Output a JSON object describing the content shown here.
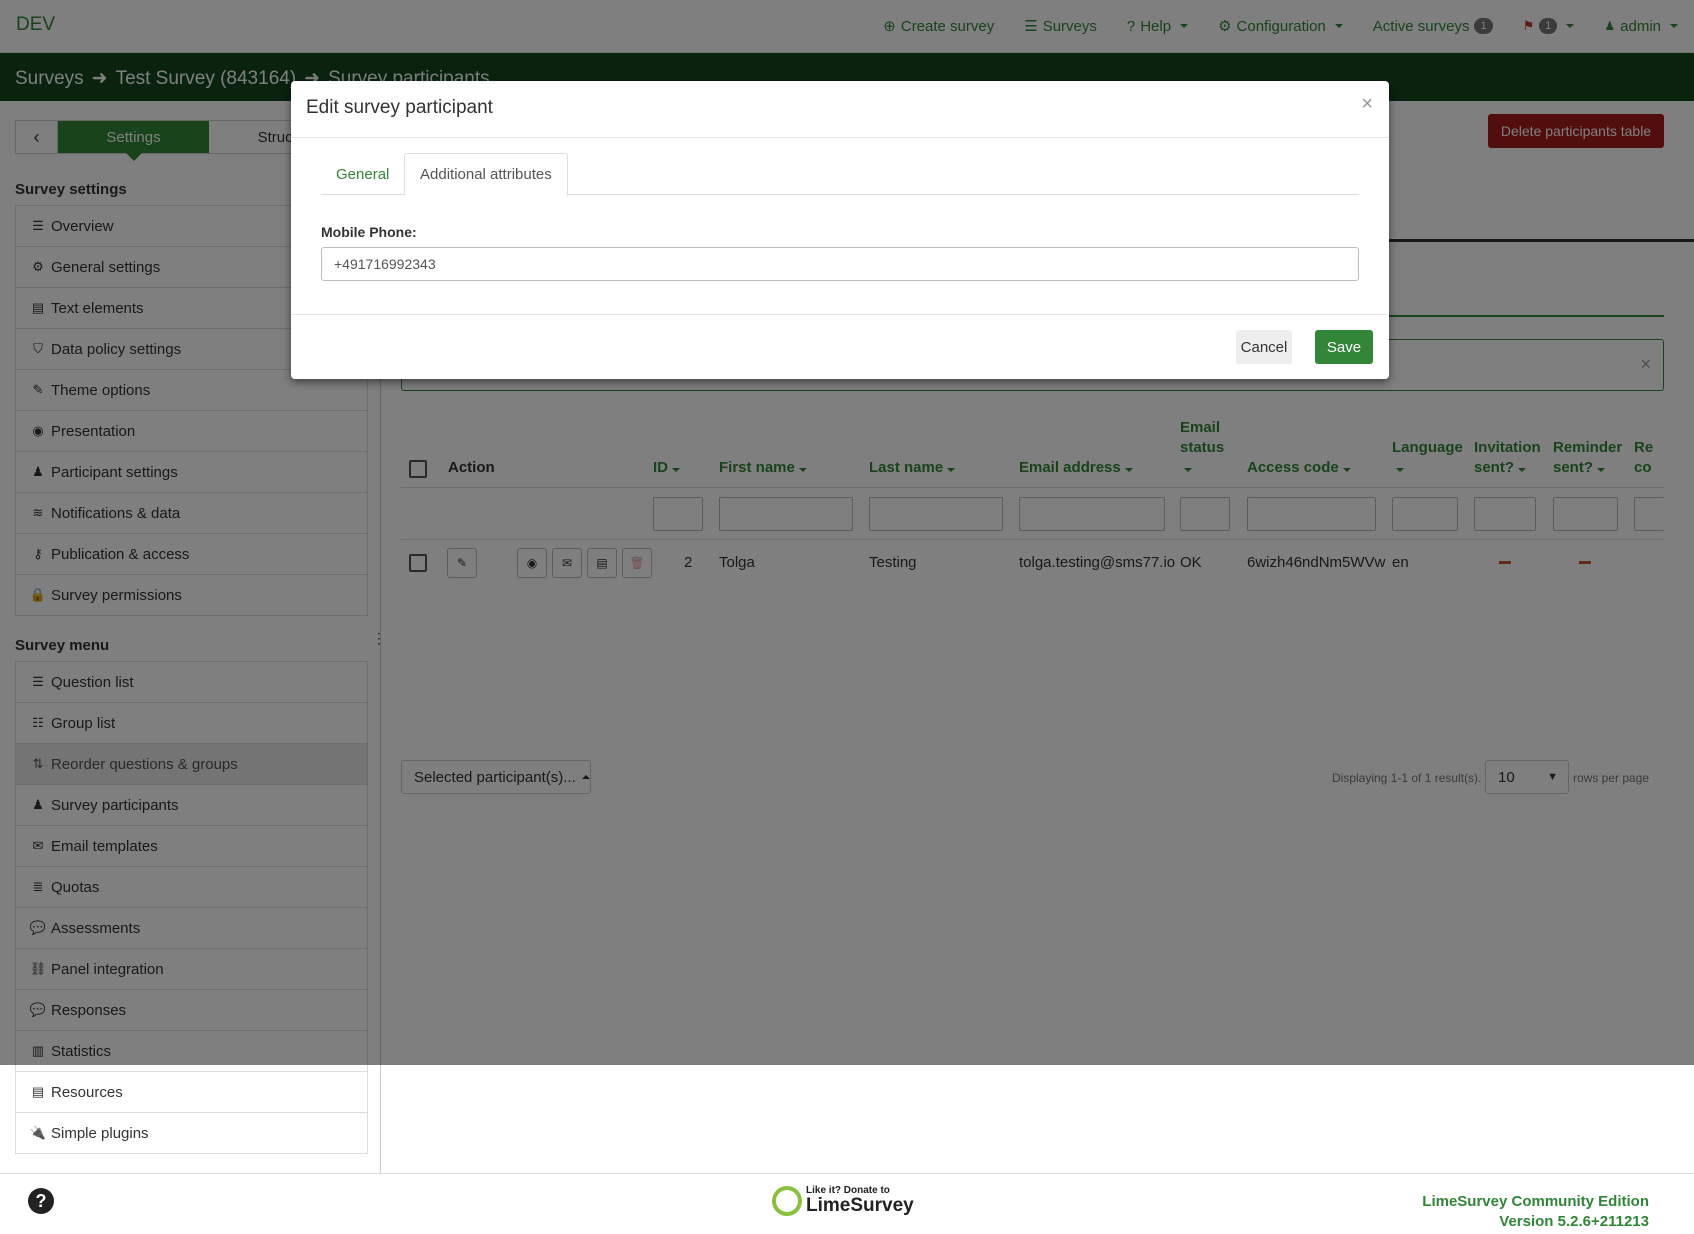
{
  "navbar": {
    "brand": "DEV",
    "items": [
      {
        "icon": "plus-circle-icon",
        "glyph": "⊕",
        "label": "Create survey"
      },
      {
        "icon": "list-icon",
        "glyph": "☰",
        "label": "Surveys"
      },
      {
        "icon": "question-circle-icon",
        "glyph": "?",
        "label": "Help"
      },
      {
        "icon": "cogs-icon",
        "glyph": "⚙",
        "label": "Configuration"
      },
      {
        "label": "Active surveys",
        "badge": "1"
      },
      {
        "icon": "bell-icon",
        "glyph": "🔔",
        "badge": "1"
      },
      {
        "icon": "user-icon",
        "glyph": "👤",
        "label": "admin"
      }
    ]
  },
  "breadcrumb": {
    "item1": "Surveys",
    "item2": "Test Survey (843164)",
    "item3": "Survey participants"
  },
  "sidebar": {
    "tab_settings": "Settings",
    "tab_structure": "Structure",
    "settings_title": "Survey settings",
    "settings_items": [
      {
        "glyph": "☰",
        "label": "Overview"
      },
      {
        "glyph": "⚙",
        "label": "General settings"
      },
      {
        "glyph": "▤",
        "label": "Text elements"
      },
      {
        "glyph": "⛉",
        "label": "Data policy settings"
      },
      {
        "glyph": "✎",
        "label": "Theme options"
      },
      {
        "glyph": "◉",
        "label": "Presentation"
      },
      {
        "glyph": "♟",
        "label": "Participant settings"
      },
      {
        "glyph": "≋",
        "label": "Notifications & data"
      },
      {
        "glyph": "⚷",
        "label": "Publication & access"
      },
      {
        "glyph": "🔒",
        "label": "Survey permissions"
      }
    ],
    "menu_title": "Survey menu",
    "menu_items": [
      {
        "glyph": "☰",
        "label": "Question list"
      },
      {
        "glyph": "☷",
        "label": "Group list"
      },
      {
        "glyph": "⇅",
        "label": "Reorder questions & groups"
      },
      {
        "glyph": "♟",
        "label": "Survey participants"
      },
      {
        "glyph": "✉",
        "label": "Email templates"
      },
      {
        "glyph": "≣",
        "label": "Quotas"
      },
      {
        "glyph": "💬",
        "label": "Assessments"
      },
      {
        "glyph": "⛓",
        "label": "Panel integration"
      },
      {
        "glyph": "💬",
        "label": "Responses"
      },
      {
        "glyph": "▥",
        "label": "Statistics"
      },
      {
        "glyph": "▤",
        "label": "Resources"
      },
      {
        "glyph": "🔌",
        "label": "Simple plugins"
      }
    ]
  },
  "main": {
    "delete_button": "Delete participants table",
    "table": {
      "headers": {
        "action": "Action",
        "id": "ID",
        "first_name": "First name",
        "last_name": "Last name",
        "email": "Email address",
        "email_status_1": "Email",
        "email_status_2": "status",
        "access_code": "Access code",
        "language": "Language",
        "invitation_1": "Invitation",
        "invitation_2": "sent?",
        "reminder_1": "Reminder",
        "reminder_2": "sent?",
        "extra_1": "Re",
        "extra_2": "co"
      },
      "row": {
        "id": "2",
        "first_name": "Tolga",
        "last_name": "Testing",
        "email": "tolga.testing@sms77.io",
        "email_status": "OK",
        "access_code": "6wizh46ndNm5WVw",
        "language": "en"
      }
    },
    "selected_button": "Selected participant(s)...",
    "pager_text": "Displaying 1-1 of 1 result(s).",
    "rows_per_page_value": "10",
    "rows_per_page_label": "rows per page"
  },
  "footer": {
    "logo_small": "Like it? Donate to",
    "logo_big": "LimeSurvey",
    "edition": "LimeSurvey Community Edition",
    "version": "Version 5.2.6+211213"
  },
  "modal": {
    "title": "Edit survey participant",
    "close": "×",
    "tab_general": "General",
    "tab_additional": "Additional attributes",
    "field_label": "Mobile Phone:",
    "field_value": "+491716992343",
    "cancel": "Cancel",
    "save": "Save"
  },
  "colors": {
    "brand_green": "#328637",
    "dark_green": "#14471e",
    "danger": "#a51b1b"
  }
}
